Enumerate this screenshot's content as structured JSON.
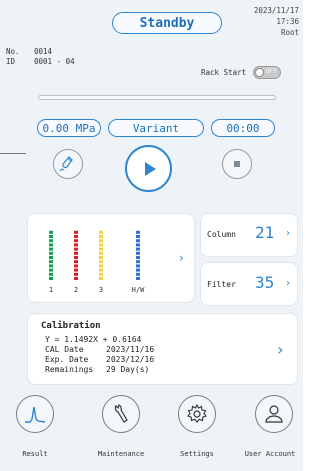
{
  "status": "Standby",
  "datetime": {
    "date": "2023/11/17",
    "time": "17:36",
    "user": "Root"
  },
  "sample": {
    "no_label": "No.",
    "no_value": "0014",
    "id_label": "ID",
    "id_value": "0001 - 04"
  },
  "rack_start": {
    "label": "Rack Start",
    "toggle_state": "OFF"
  },
  "progress": 0,
  "readouts": {
    "pressure": "0.00 MPa",
    "mode": "Variant",
    "timer": "00:00"
  },
  "reagents": {
    "bars": [
      {
        "label": "1",
        "color": "#12a34a"
      },
      {
        "label": "2",
        "color": "#e01e1e"
      },
      {
        "label": "3",
        "color": "#f2d43a"
      },
      {
        "label": "H/W",
        "color": "#2f6fd0"
      }
    ],
    "level_fraction": 1.0
  },
  "column": {
    "label": "Column",
    "value": "21"
  },
  "filter": {
    "label": "Filter",
    "value": "35"
  },
  "calibration": {
    "title": "Calibration",
    "equation": "Y = 1.1492X + 0.6164",
    "cal_date_label": "CAL Date",
    "cal_date": "2023/11/16",
    "exp_date_label": "Exp. Date",
    "exp_date": "2023/12/16",
    "remaining_label": "Remainings",
    "remaining": "29 Day(s)"
  },
  "nav": [
    {
      "label": "Result",
      "icon": "chart-peak-icon"
    },
    {
      "label": "Maintenance",
      "icon": "wrench-icon"
    },
    {
      "label": "Settings",
      "icon": "gear-icon"
    },
    {
      "label": "User Account",
      "icon": "user-icon"
    }
  ],
  "colors": {
    "accent": "#2f86d0"
  }
}
